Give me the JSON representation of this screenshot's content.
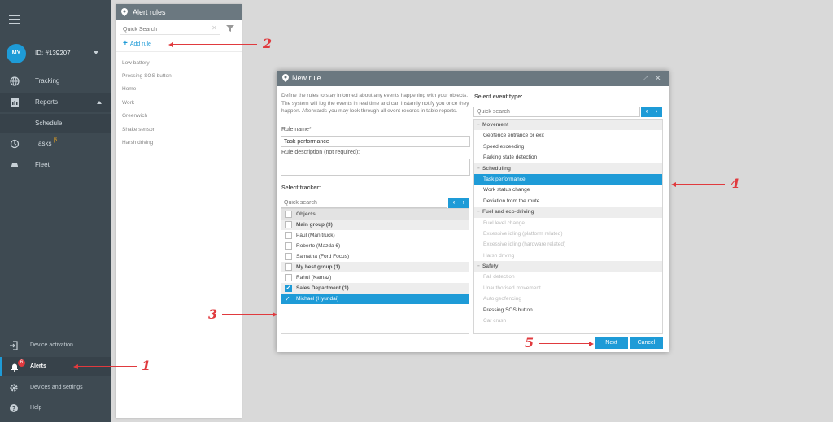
{
  "sidebar": {
    "avatar": "MY",
    "account_id": "ID: #139207",
    "items": [
      {
        "label": "Tracking",
        "icon": "globe-icon"
      },
      {
        "label": "Reports",
        "icon": "chart-icon"
      },
      {
        "label": "Schedule",
        "icon": ""
      },
      {
        "label": "Tasks",
        "icon": "clock-icon"
      },
      {
        "label": "Fleet",
        "icon": "car-icon"
      }
    ],
    "tasks_beta": "β",
    "bottom_items": [
      {
        "label": "Device activation",
        "icon": "login-icon"
      },
      {
        "label": "Alerts",
        "icon": "bell-icon"
      },
      {
        "label": "Devices and settings",
        "icon": "gear-icon"
      },
      {
        "label": "Help",
        "icon": "help-icon"
      }
    ],
    "alerts_badge": "6"
  },
  "rules_panel": {
    "title": "Alert rules",
    "search_placeholder": "Quick Search",
    "add_rule": "Add rule",
    "rules": [
      "Low battery",
      "Pressing SOS button",
      "Home",
      "Work",
      "Greenwich",
      "Shake sensor",
      "Harsh driving"
    ]
  },
  "modal": {
    "title": "New rule",
    "description": "Define the rules to stay informed about any events happening with your objects. The system will log the events in real time and can instantly notify you once they happen. Afterwards you may look through all event records in table reports.",
    "rule_name_label": "Rule name*:",
    "rule_name_value": "Task performance",
    "rule_desc_label": "Rule description (not required):",
    "select_tracker_label": "Select tracker:",
    "tracker_search_placeholder": "Quick search",
    "trackers_header": "Objects",
    "tracker_rows": [
      {
        "label": "Main group (3)",
        "type": "group"
      },
      {
        "label": "Paul (Man truck)",
        "type": "item"
      },
      {
        "label": "Roberto (Mazda 6)",
        "type": "item"
      },
      {
        "label": "Samatha (Ford Focus)",
        "type": "item"
      },
      {
        "label": "My best group (1)",
        "type": "group"
      },
      {
        "label": "Rahul (Kamaz)",
        "type": "item"
      },
      {
        "label": "Sales Department (1)",
        "type": "group-checked"
      },
      {
        "label": "Michael (Hyundai)",
        "type": "selected"
      }
    ],
    "select_event_label": "Select event type:",
    "event_search_placeholder": "Quick search",
    "event_rows": [
      {
        "label": "Movement",
        "type": "cat"
      },
      {
        "label": "Geofence entrance or exit",
        "type": "item"
      },
      {
        "label": "Speed exceeding",
        "type": "item"
      },
      {
        "label": "Parking state detection",
        "type": "item"
      },
      {
        "label": "Scheduling",
        "type": "cat"
      },
      {
        "label": "Task performance",
        "type": "selected"
      },
      {
        "label": "Work status change",
        "type": "item"
      },
      {
        "label": "Deviation from the route",
        "type": "item"
      },
      {
        "label": "Fuel and eco-driving",
        "type": "cat"
      },
      {
        "label": "Fuel level change",
        "type": "disabled"
      },
      {
        "label": "Excessive idling (platform related)",
        "type": "disabled"
      },
      {
        "label": "Excessive idling (hardware related)",
        "type": "disabled"
      },
      {
        "label": "Harsh driving",
        "type": "disabled"
      },
      {
        "label": "Safety",
        "type": "cat"
      },
      {
        "label": "Fall detection",
        "type": "disabled"
      },
      {
        "label": "Unauthorised movement",
        "type": "disabled"
      },
      {
        "label": "Auto geofencing",
        "type": "disabled"
      },
      {
        "label": "Pressing SOS button",
        "type": "item"
      },
      {
        "label": "Car crash",
        "type": "disabled"
      }
    ],
    "next_button": "Next",
    "cancel_button": "Cancel"
  },
  "annotations": [
    "1",
    "2",
    "3",
    "4",
    "5"
  ],
  "colors": {
    "accent": "#1e9bd7",
    "sidebar": "#3e4a52",
    "annotation": "#e03a3e",
    "header": "#6b7880"
  }
}
